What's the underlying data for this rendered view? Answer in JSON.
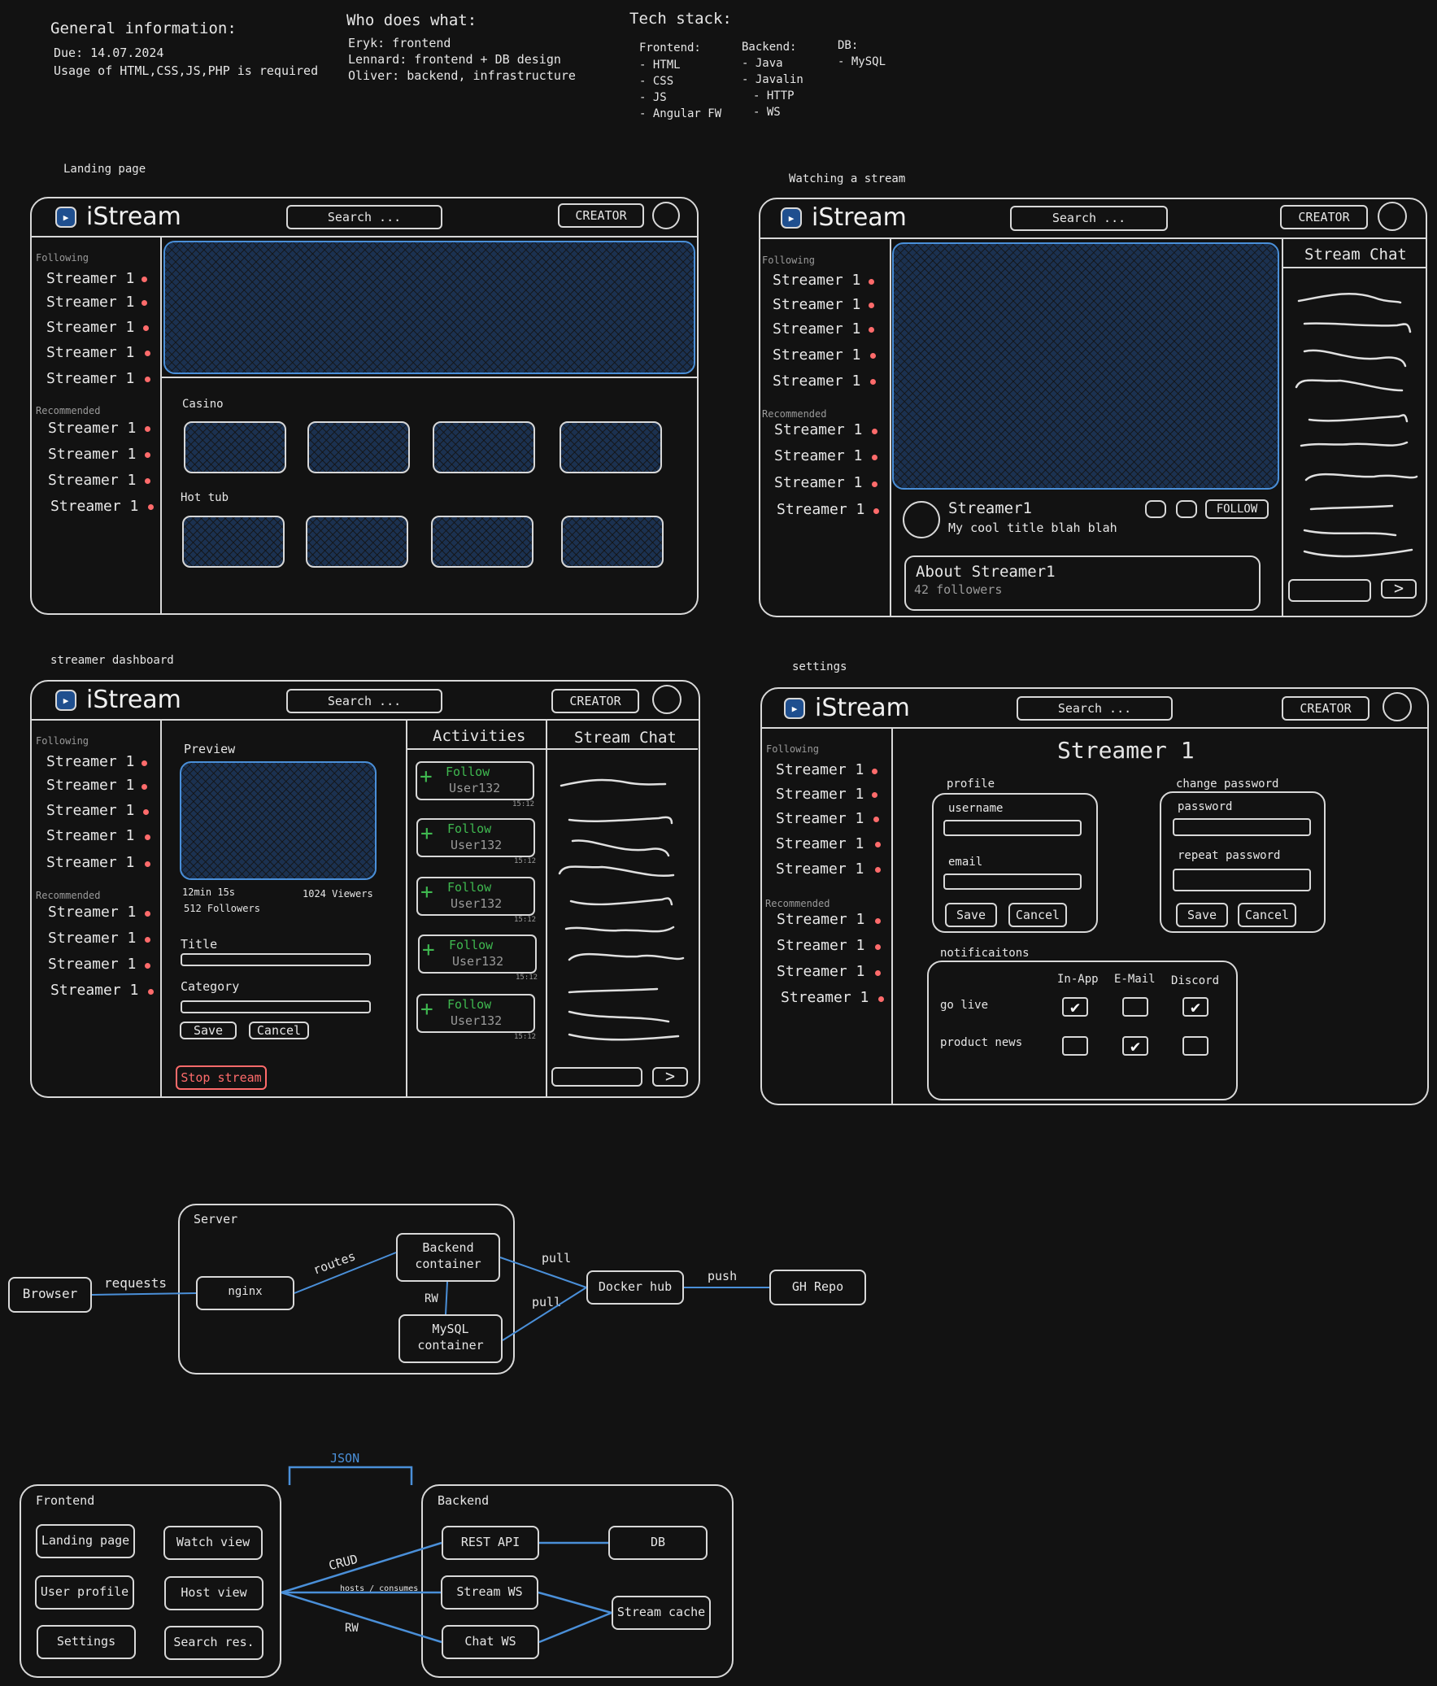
{
  "header": {
    "general_title": "General information:",
    "due": "Due: 14.07.2024",
    "usage": "Usage of HTML,CSS,JS,PHP is required",
    "who_title": "Who does what:",
    "who": [
      "Eryk: frontend",
      "Lennard: frontend + DB design",
      "Oliver: backend, infrastructure"
    ],
    "tech_title": "Tech stack:",
    "frontend_title": "Frontend:",
    "frontend": [
      "- HTML",
      "- CSS",
      "- JS",
      "- Angular FW"
    ],
    "backend_title": "Backend:",
    "backend": [
      "- Java",
      "- Javalin",
      "- HTTP",
      "- WS"
    ],
    "db_title": "DB:",
    "db": [
      "- MySQL"
    ]
  },
  "common": {
    "brand": "iStream",
    "search": "Search ...",
    "creator": "CREATOR",
    "following": "Following",
    "recommended": "Recommended",
    "streamer": "Streamer 1",
    "stream_chat": "Stream Chat",
    "save": "Save",
    "cancel": "Cancel"
  },
  "screens": {
    "landing": {
      "caption": "Landing page",
      "section1": "Casino",
      "section2": "Hot tub"
    },
    "watch": {
      "caption": "Watching a stream",
      "streamer_name": "Streamer1",
      "stream_title": "My cool title blah blah",
      "follow": "FOLLOW",
      "about": "About Streamer1",
      "followers": "42 followers"
    },
    "dashboard": {
      "caption": "streamer dashboard",
      "preview": "Preview",
      "uptime": "12min 15s",
      "viewers": "1024 Viewers",
      "followers": "512 Followers",
      "title_label": "Title",
      "category_label": "Category",
      "stop": "Stop stream",
      "activities": "Activities",
      "activity_action": "Follow",
      "activity_user": "User132",
      "activity_time": "15:12"
    },
    "settings": {
      "caption": "settings",
      "heading": "Streamer 1",
      "profile": "profile",
      "username": "username",
      "email": "email",
      "change_password": "change password",
      "password": "password",
      "repeat_password": "repeat password",
      "notifications": "notificaitons",
      "col_inapp": "In-App",
      "col_email": "E-Mail",
      "col_discord": "Discord",
      "row_golive": "go live",
      "row_product": "product news",
      "checks": [
        [
          true,
          false,
          true
        ],
        [
          false,
          true,
          false
        ]
      ]
    }
  },
  "infra": {
    "browser": "Browser",
    "requests": "requests",
    "server": "Server",
    "nginx": "nginx",
    "routes": "routes",
    "backend_container": [
      "Backend",
      "container"
    ],
    "rw": "RW",
    "mysql_container": [
      "MySQL",
      "container"
    ],
    "pull1": "pull",
    "pull2": "pull",
    "docker": "Docker hub",
    "push": "push",
    "gh": "GH Repo"
  },
  "arch": {
    "json": "JSON",
    "frontend": "Frontend",
    "fe_items": [
      "Landing page",
      "Watch view",
      "User profile",
      "Host view",
      "Settings",
      "Search res."
    ],
    "crud": "CRUD",
    "hosts": "hosts / consumes",
    "rw": "RW",
    "backend": "Backend",
    "rest": "REST API",
    "db": "DB",
    "stream_ws": "Stream WS",
    "stream_cache": "Stream cache",
    "chat_ws": "Chat WS"
  },
  "colors": {
    "accent_blue": "#4a8fd8",
    "live_dot": "#ff6b6b",
    "follow_green": "#3fb950",
    "stop_red": "#ff6b6b"
  }
}
